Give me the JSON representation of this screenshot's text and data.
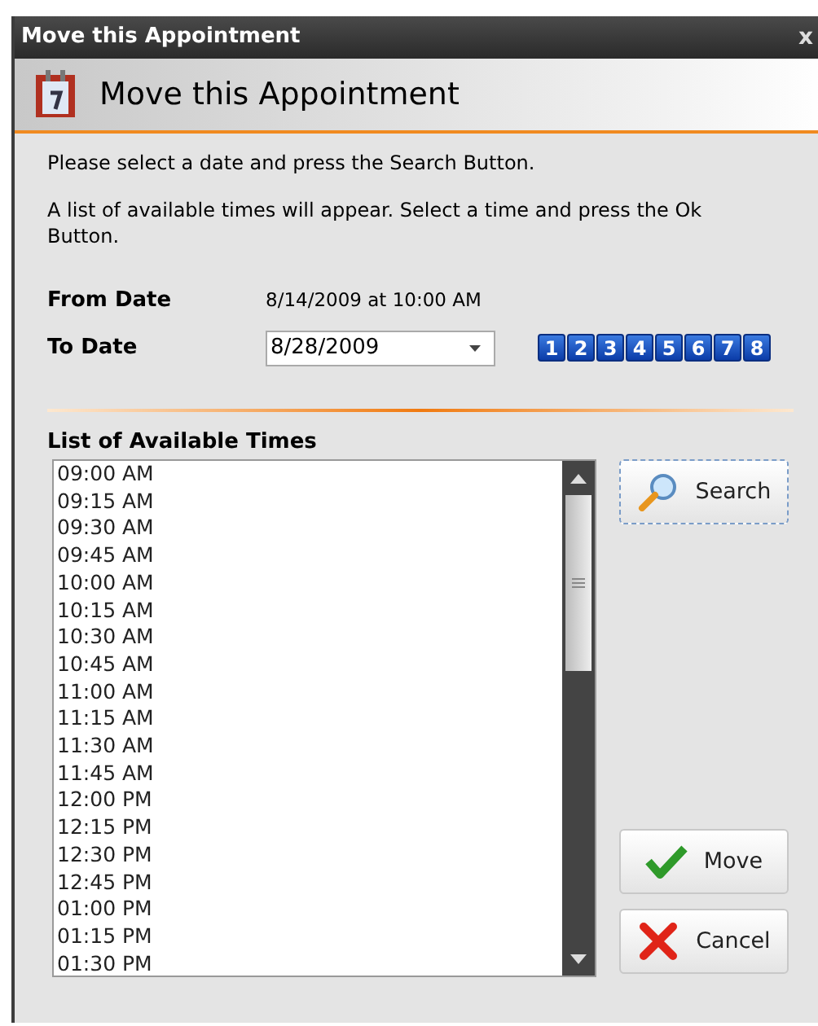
{
  "window": {
    "title": "Move this Appointment",
    "close": "x"
  },
  "header": {
    "title": "Move this Appointment"
  },
  "instructions": [
    "Please select a date and press the Search Button.",
    "A list of available times will appear.  Select a time and press the Ok Button."
  ],
  "from_date": {
    "label": "From Date",
    "value": "8/14/2009 at 10:00 AM"
  },
  "to_date": {
    "label": "To Date",
    "value": "8/28/2009"
  },
  "week_buttons": [
    "1",
    "2",
    "3",
    "4",
    "5",
    "6",
    "7",
    "8"
  ],
  "times": {
    "label": "List of Available Times",
    "items": [
      "09:00 AM",
      "09:15 AM",
      "09:30 AM",
      "09:45 AM",
      "10:00 AM",
      "10:15 AM",
      "10:30 AM",
      "10:45 AM",
      "11:00 AM",
      "11:15 AM",
      "11:30 AM",
      "11:45 AM",
      "12:00 PM",
      "12:15 PM",
      "12:30 PM",
      "12:45 PM",
      "01:00 PM",
      "01:15 PM",
      "01:30 PM"
    ]
  },
  "buttons": [
    {
      "kind": "search",
      "label": "Search"
    },
    {
      "kind": "move",
      "label": "Move"
    },
    {
      "kind": "cancel",
      "label": "Cancel"
    }
  ]
}
